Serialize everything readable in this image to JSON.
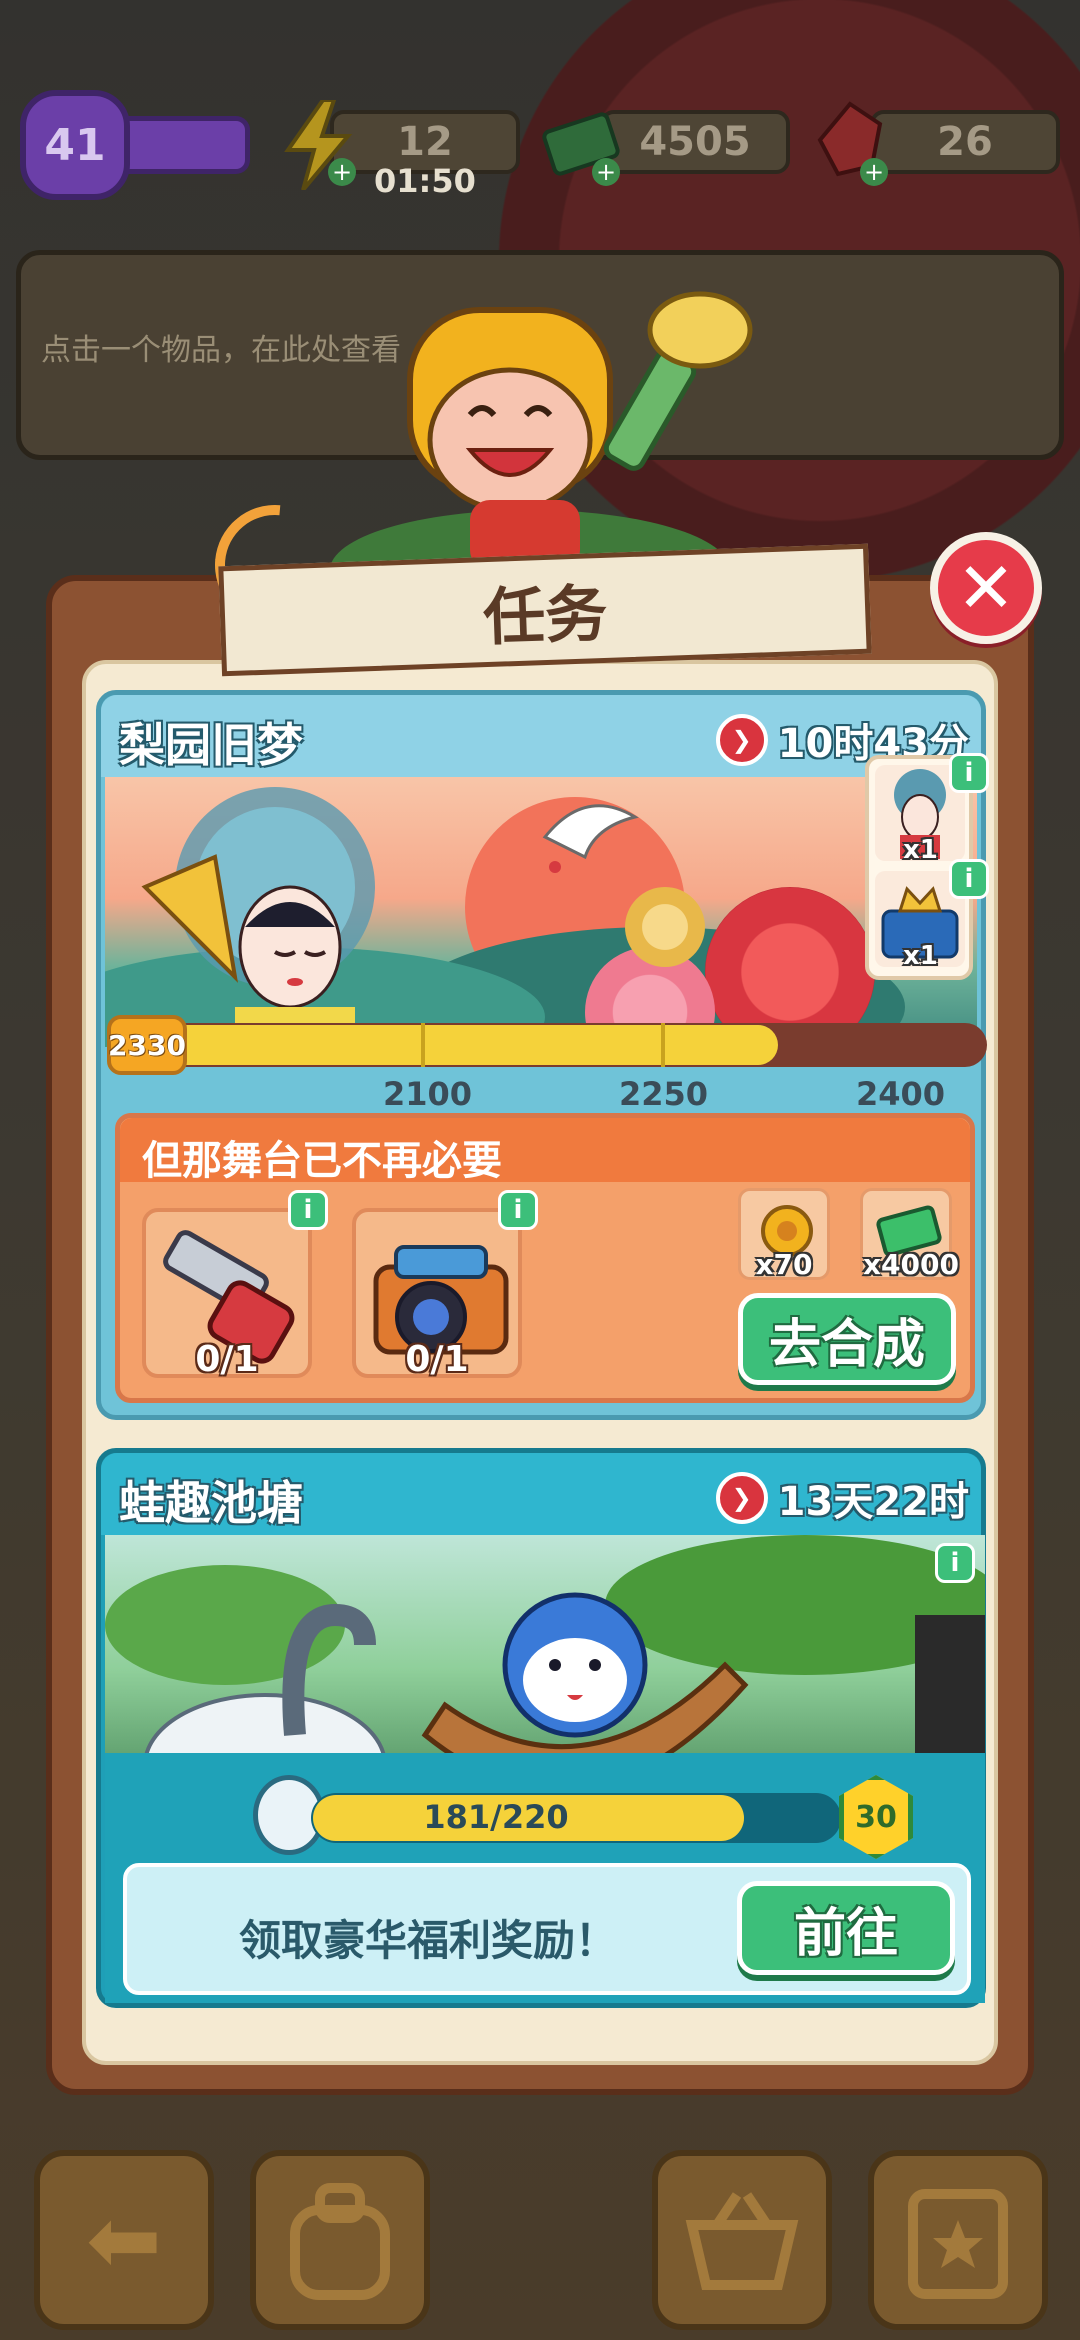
{
  "status_bar": {
    "level": "41",
    "energy": "12",
    "energy_timer": "01:50",
    "cash": "4505",
    "gems": "26"
  },
  "info_panel": {
    "hint": "点击一个物品，在此处查看"
  },
  "task_panel": {
    "title": "任务",
    "close_icon": "close-icon"
  },
  "event_one": {
    "title": "梨园旧梦",
    "timer": "10时43分",
    "score": "2330",
    "progress": 0.76,
    "milestones": [
      "2100",
      "2250",
      "2400"
    ],
    "rewards": [
      {
        "icon": "opera-doll-icon",
        "qty": "x1"
      },
      {
        "icon": "crown-chest-icon",
        "qty": "x1"
      }
    ],
    "quest": {
      "title": "但那舞台已不再必要",
      "items": [
        {
          "icon": "saw-icon",
          "count": "0/1"
        },
        {
          "icon": "camera-icon",
          "count": "0/1"
        }
      ],
      "rewards": [
        {
          "icon": "flower-coin-icon",
          "qty": "x70"
        },
        {
          "icon": "cash-icon",
          "qty": "x4000"
        }
      ],
      "button": "去合成"
    }
  },
  "event_two": {
    "title": "蛙趣池塘",
    "timer": "13天22时",
    "progress_text": "181/220",
    "progress": 0.82,
    "level": "30",
    "welfare_text": "领取豪华福利奖励！",
    "button": "前往"
  },
  "bottom_nav": [
    "back-arrow-icon",
    "backpack-icon",
    "basket-icon",
    "quest-board-icon"
  ],
  "colors": {
    "accent_green": "#3cbf7a",
    "close_red": "#e63b4a",
    "progress_yellow": "#f5d23a",
    "panel_brown": "#8c5232"
  }
}
